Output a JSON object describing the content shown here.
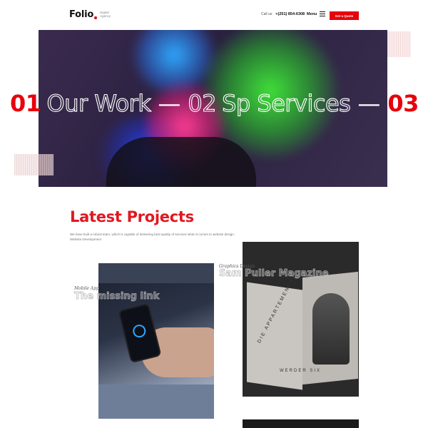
{
  "header": {
    "logo": {
      "word": "Folio",
      "tagline": "Digital Agency"
    },
    "call_label": "Call us",
    "phone": "+(251) 854-6308",
    "menu_label": "Menu",
    "quote_button": "Get a Quote"
  },
  "hero": {
    "marquee": [
      {
        "number": "01",
        "label": "Our Work"
      },
      {
        "number": "02",
        "label": "Sp Services"
      },
      {
        "number": "03",
        "label": ""
      }
    ],
    "separator": "—"
  },
  "projects": {
    "title": "Latest Projects",
    "description": "We have built a robust team, which is capable of delivering best quality of services when it comes to website design, Website Development",
    "items": [
      {
        "category": "Mobile App",
        "title": "The missing link"
      },
      {
        "category": "Graphics Design",
        "title": "Sam Puller Magazine"
      }
    ],
    "magazine_text": {
      "vertical": "DIE APPARTEMENTS",
      "bottom": "WERDER SIX"
    }
  },
  "colors": {
    "accent": "#e8000b",
    "heading": "#e01820"
  }
}
